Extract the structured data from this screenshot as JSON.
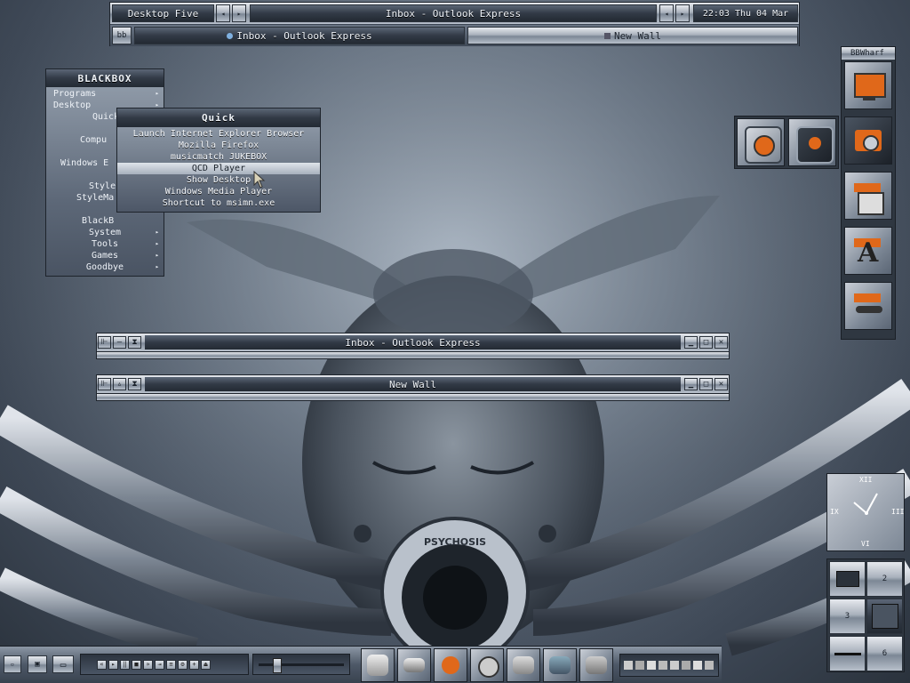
{
  "toolbar": {
    "workspace": "Desktop Five",
    "current_window": "Inbox - Outlook Express",
    "clock": "22:03 Thu 04 Mar",
    "bb_label": "bb",
    "tasks": [
      {
        "label": "Inbox - Outlook Express"
      },
      {
        "label": "New Wall"
      }
    ]
  },
  "menu": {
    "title": "BLACKBOX",
    "items": [
      {
        "label": "Programs",
        "sub": true
      },
      {
        "label": "Desktop",
        "sub": true
      },
      {
        "label": "Quick",
        "sub": true
      },
      {
        "label": "",
        "sub": false
      },
      {
        "label": "Compu",
        "sub": false
      },
      {
        "label": "",
        "sub": false
      },
      {
        "label": "Windows E",
        "sub": false
      },
      {
        "label": "",
        "sub": false
      },
      {
        "label": "Style",
        "sub": false
      },
      {
        "label": "StyleMa",
        "sub": false
      },
      {
        "label": "",
        "sub": false
      },
      {
        "label": "BlackB",
        "sub": false
      },
      {
        "label": "System",
        "sub": true
      },
      {
        "label": "Tools",
        "sub": true
      },
      {
        "label": "Games",
        "sub": true
      },
      {
        "label": "Goodbye",
        "sub": true
      }
    ]
  },
  "submenu": {
    "title": "Quick",
    "items": [
      {
        "label": "Launch Internet Explorer Browser"
      },
      {
        "label": "Mozilla Firefox"
      },
      {
        "label": "musicmatch JUKEBOX"
      },
      {
        "label": "QCD Player",
        "highlight": true
      },
      {
        "label": "Show Desktop"
      },
      {
        "label": "Windows Media Player"
      },
      {
        "label": "Shortcut to msimn.exe"
      }
    ]
  },
  "windows": [
    {
      "title": "Inbox - Outlook Express"
    },
    {
      "title": "New Wall"
    }
  ],
  "bbwharf": {
    "title": "BBWharf",
    "icons": [
      "monitor-icon",
      "media-player-icon",
      "calculator-icon",
      "font-icon",
      "trumpet-icon"
    ]
  },
  "floating_icons": [
    "media-player-icon",
    "qcd-player-icon"
  ],
  "clock_widget": {
    "numerals": {
      "top": "XII",
      "left": "IX",
      "right": "III",
      "bottom": "VI"
    }
  },
  "pager": {
    "desktops": [
      "",
      "2",
      "3",
      "",
      "",
      "6"
    ]
  },
  "background": {
    "logo_text": "PSYCHOSIS"
  },
  "colors": {
    "accent_orange": "#e0681a",
    "metal_light": "#e6e9ee",
    "metal_dark": "#323a46"
  }
}
